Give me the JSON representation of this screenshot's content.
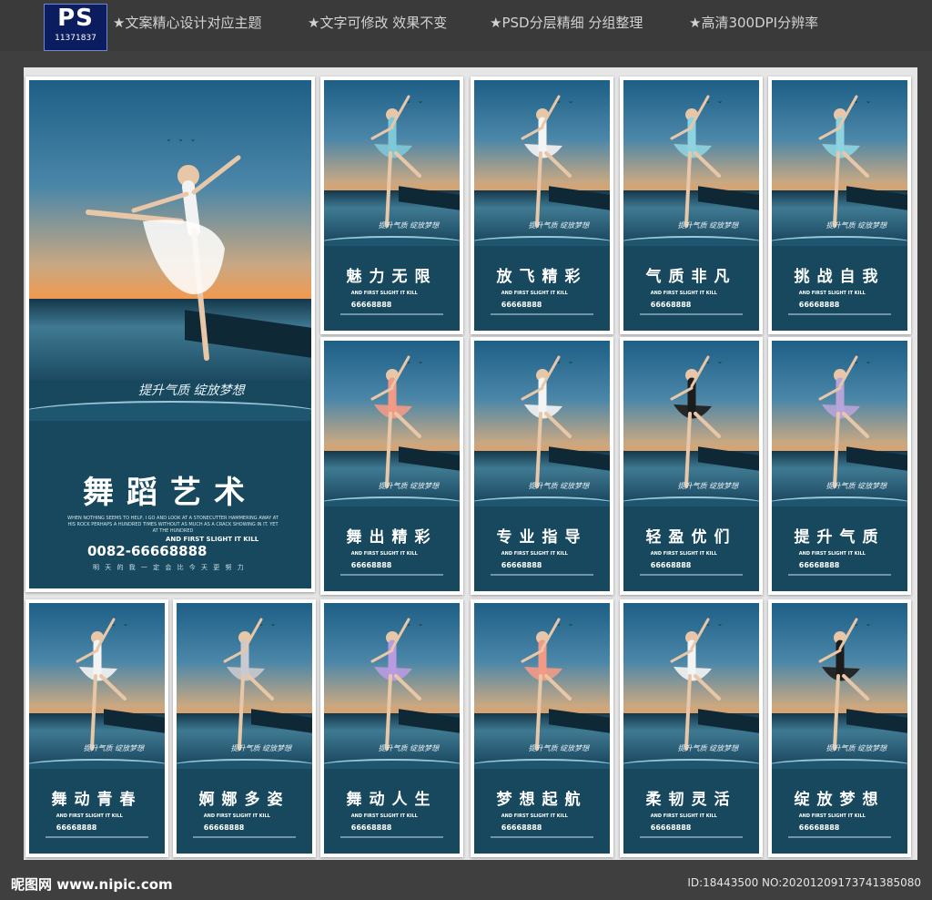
{
  "header": {
    "ps_label": "PS",
    "ps_number": "11371837",
    "features": [
      "★文案精心设计对应主题",
      "★文字可修改 效果不变",
      "★PSD分层精细 分组整理",
      "★高清300DPI分辨率"
    ]
  },
  "main_poster": {
    "title": "舞蹈艺术",
    "tagline": "提升气质 绽放梦想",
    "body_text": "WHEN NOTHING SEEMS TO HELP, I GO AND LOOK AT A STONECUTTER HAMMERING AWAY AT HIS ROCK PERHAPS A HUNDRED TIMES WITHOUT AS MUCH AS A CRACK SHOWING IN IT. YET AT THE HUNDRED",
    "slogan": "AND FIRST SLIGHT IT KILL",
    "phone": "0082-66668888",
    "bottom_line": "明 天 的 我 一 定 会 比 今 天 更 努 力"
  },
  "posters": [
    {
      "title": "魅力无限"
    },
    {
      "title": "放飞精彩"
    },
    {
      "title": "气质非凡"
    },
    {
      "title": "挑战自我"
    },
    {
      "title": "舞出精彩"
    },
    {
      "title": "专业指导"
    },
    {
      "title": "轻盈优们"
    },
    {
      "title": "提升气质"
    },
    {
      "title": "舞动青春"
    },
    {
      "title": "婀娜多姿"
    },
    {
      "title": "舞动人生"
    },
    {
      "title": "梦想起航"
    },
    {
      "title": "柔韧灵活"
    },
    {
      "title": "绽放梦想"
    }
  ],
  "poster_common": {
    "slogan": "AND FIRST SLIGHT IT KILL",
    "phone": "66668888",
    "tagline": "提升气质 绽放梦想"
  },
  "footer": {
    "site": "昵图网 www.nipic.com",
    "image_id": "ID:18443500 NO:20201209173741385080"
  },
  "colors": {
    "panel": "#17485d",
    "background": "#3f3f3f",
    "frame": "#e6e6e6"
  },
  "dress_colors": [
    "#7fc8d8",
    "#f4f4f4",
    "#8fd3e0",
    "#8fd3e0",
    "#f29a86",
    "#f4f4f4",
    "#1c1c1c",
    "#b7a4d8",
    "#f4f4f4",
    "#c9c9d0",
    "#b89be0",
    "#f29a86",
    "#f4f4f4",
    "#1c1c1c"
  ]
}
